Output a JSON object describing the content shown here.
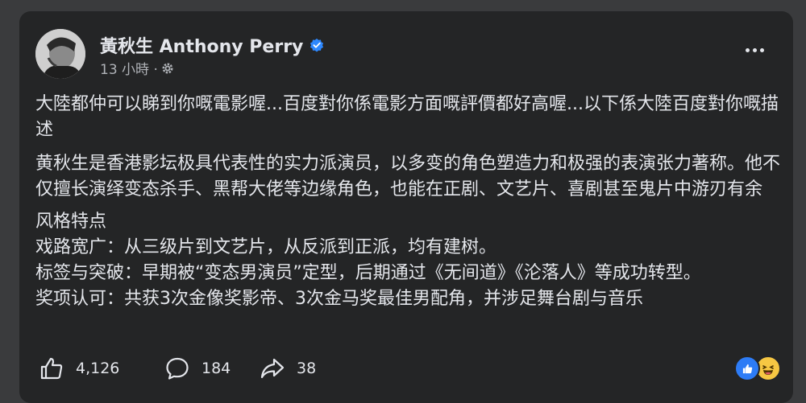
{
  "post": {
    "author_name": "黃秋生 Anthony Perry",
    "timestamp": "13 小時 ·",
    "paragraphs": {
      "p1": "大陸都仲可以睇到你嘅電影喔...百度對你係電影方面嘅評價都好高喔...以下係大陸百度對你嘅描述",
      "p2": "黄秋生是香港影坛极具代表性的实力派演员，以多变的角色塑造力和极强的表演张力著称。他不仅擅长演绎变态杀手、黑帮大佬等边缘角色，也能在正剧、文艺片、喜剧甚至鬼片中游刃有余",
      "p3_title": "风格特点",
      "p3_line1": "戏路宽广：从三级片到文艺片，从反派到正派，均有建树。",
      "p3_line2": "标签与突破：早期被“变态男演员”定型，后期通过《无间道》《沦落人》等成功转型。",
      "p3_line3": "奖项认可：共获3次金像奖影帝、3次金马奖最佳男配角，并涉足舞台剧与音乐"
    }
  },
  "footer": {
    "likes": "4,126",
    "comments": "184",
    "shares": "38"
  },
  "icons": {
    "verified": "verified-badge-icon",
    "privacy": "gear-icon",
    "more": "more-options-icon",
    "like": "like-icon",
    "comment": "comment-icon",
    "share": "share-icon"
  },
  "colors": {
    "background": "#242526",
    "text": "#e4e6eb",
    "secondary_text": "#b0b3b8",
    "verified_blue": "#2d88ff"
  }
}
